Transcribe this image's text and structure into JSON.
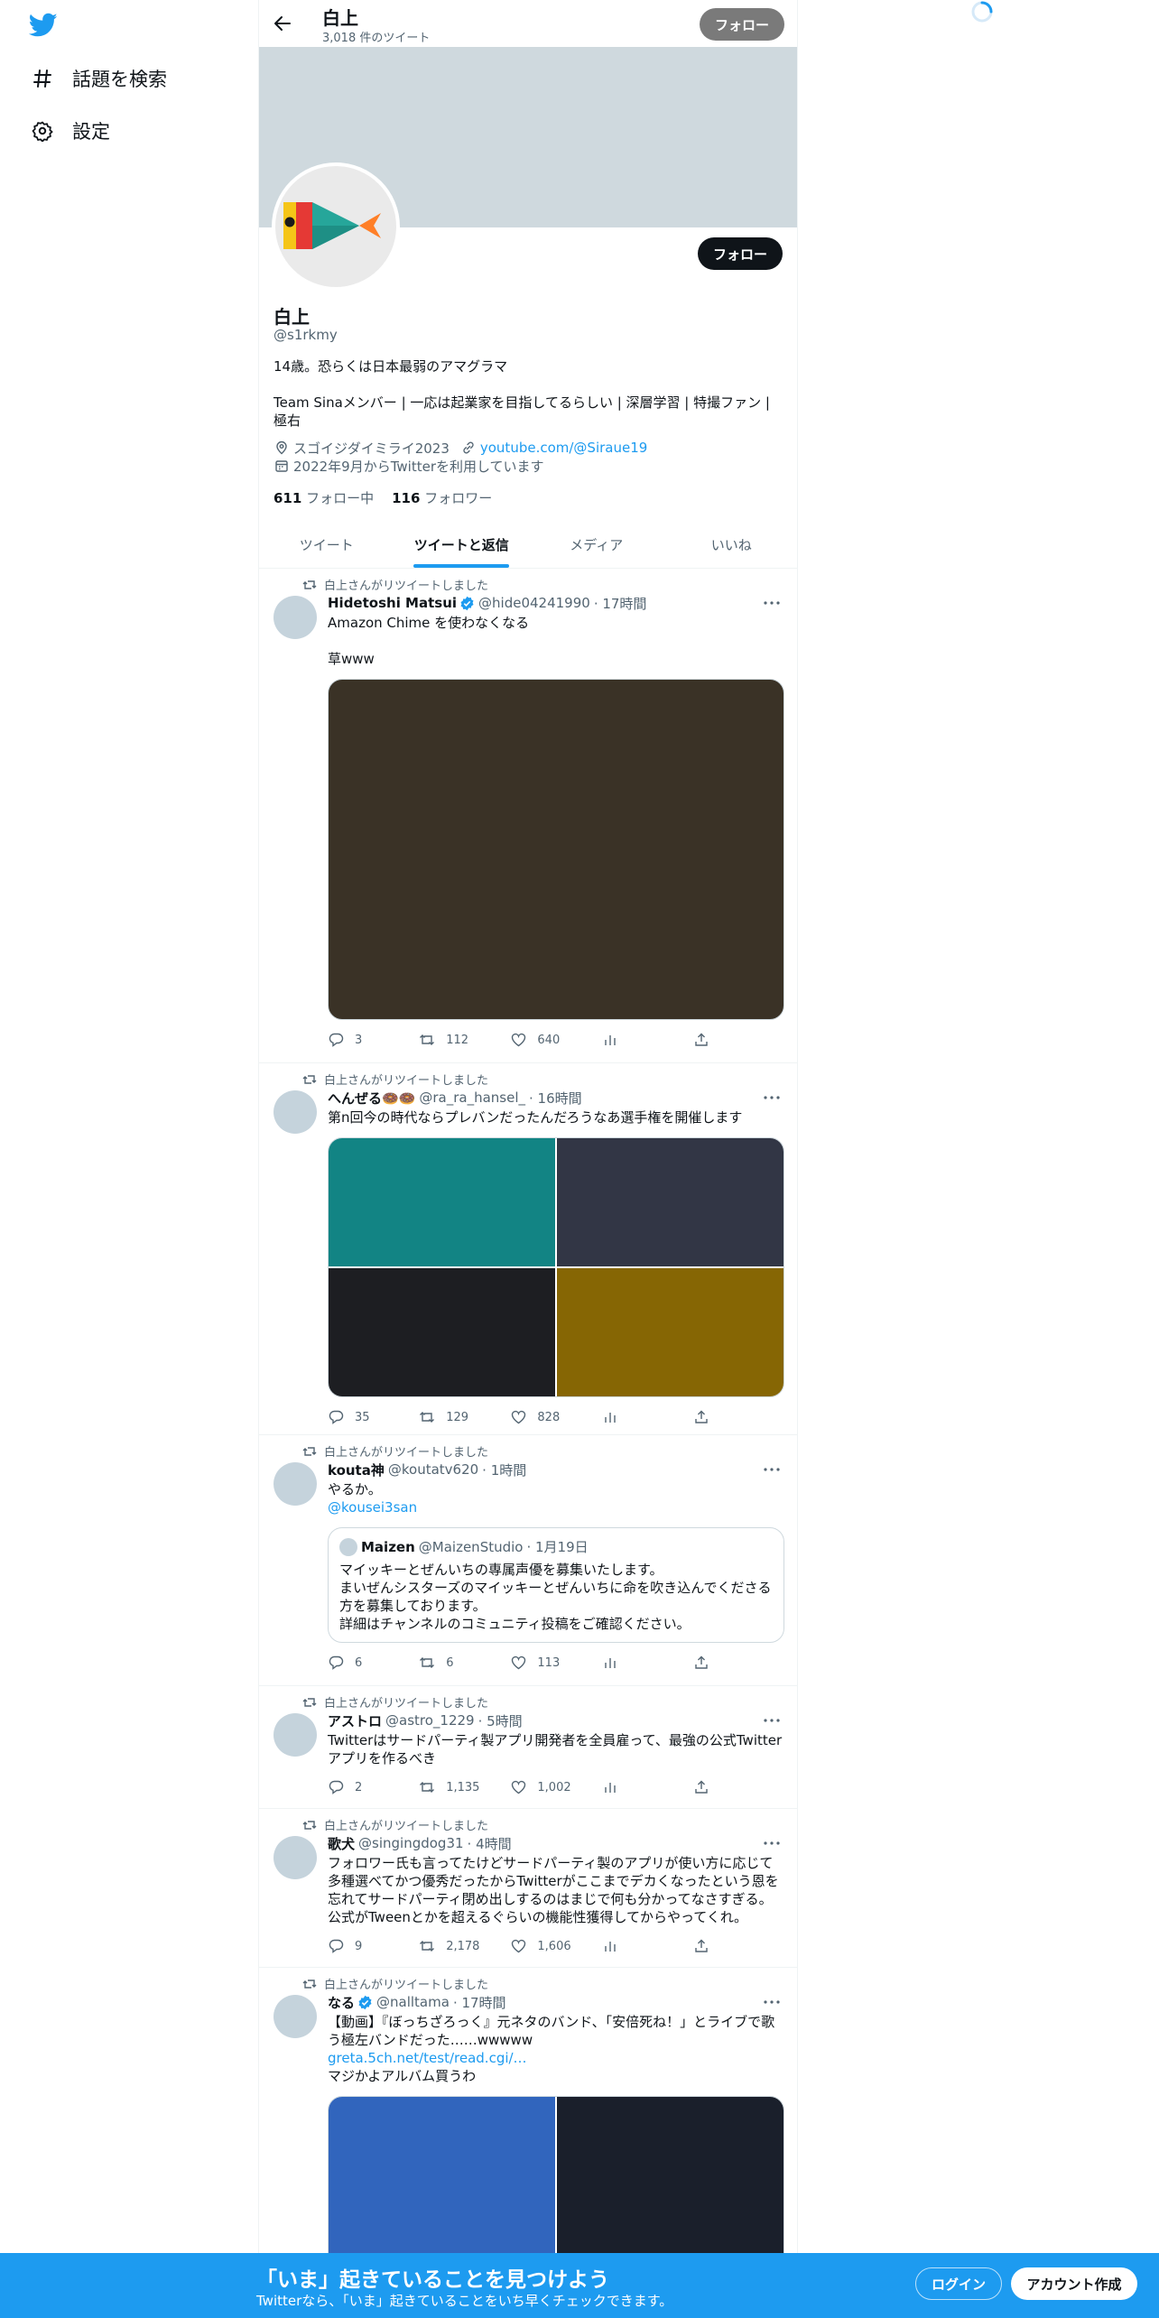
{
  "sidebar": {
    "items": [
      {
        "label": "話題を検索",
        "icon": "hashtag-icon"
      },
      {
        "label": "設定",
        "icon": "gear-icon"
      }
    ]
  },
  "header": {
    "name": "白上",
    "tweet_count": "3,018 件のツイート",
    "follow_label": "フォロー"
  },
  "profile": {
    "name": "白上",
    "handle": "@s1rkmy",
    "bio_line1": "14歳。恐らくは日本最弱のアマグラマ",
    "bio_line2": "Team Sinaメンバー | 一応は起業家を目指してるらしい | 深層学習 | 特撮ファン | 極右",
    "location": "スゴイジダイミライ2023",
    "website": "youtube.com/@Siraue19",
    "joined": "2022年9月からTwitterを利用しています",
    "following_count": "611",
    "following_label": "フォロー中",
    "followers_count": "116",
    "followers_label": "フォロワー",
    "follow_label": "フォロー",
    "avatar_colors": [
      "#f5c518",
      "#e53935",
      "#26a69a",
      "#ff7f27"
    ]
  },
  "tabs": [
    {
      "label": "ツイート",
      "active": false
    },
    {
      "label": "ツイートと返信",
      "active": true
    },
    {
      "label": "メディア",
      "active": false
    },
    {
      "label": "いいね",
      "active": false
    }
  ],
  "retweet_label": "白上さんがリツイートしました",
  "tweets": [
    {
      "name": "Hidetoshi Matsui",
      "verified": true,
      "handle": "@hide04241990",
      "time": "· 17時間",
      "text": [
        "Amazon Chime を使わなくなる",
        "",
        "草www"
      ],
      "media_colors": [
        "#3a3226"
      ],
      "replies": "3",
      "retweets": "112",
      "likes": "640"
    },
    {
      "name": "へんぜる🍩🍩",
      "verified": false,
      "handle": "@ra_ra_hansel_",
      "time": "· 16時間",
      "text": [
        "第n回今の時代ならプレバンだったんだろうなあ選手権を開催します"
      ],
      "media_colors": [
        "#128484",
        "#323645",
        "#1d1e22",
        "#866604"
      ],
      "replies": "35",
      "retweets": "129",
      "likes": "828"
    },
    {
      "name": "kouta神",
      "verified": false,
      "handle": "@koutatv620",
      "time": "· 1時間",
      "text": [
        "やるか。"
      ],
      "mention": "@kousei3san",
      "quote": {
        "name": "Maizen",
        "handle": "@MaizenStudio",
        "time": "· 1月19日",
        "lines": [
          "マイッキーとぜんいちの専属声優を募集いたします。",
          "まいぜんシスターズのマイッキーとぜんいちに命を吹き込んでくださる方を募集しております。",
          "詳細はチャンネルのコミュニティ投稿をご確認ください。"
        ]
      },
      "replies": "6",
      "retweets": "6",
      "likes": "113"
    },
    {
      "name": "アストロ",
      "verified": false,
      "handle": "@astro_1229",
      "time": "· 5時間",
      "text": [
        "Twitterはサードパーティ製アプリ開発者を全員雇って、最強の公式Twitterアプリを作るべき"
      ],
      "replies": "2",
      "retweets": "1,135",
      "likes": "1,002"
    },
    {
      "name": "歌犬",
      "verified": false,
      "handle": "@singingdog31",
      "time": "· 4時間",
      "text": [
        "フォロワー氏も言ってたけどサードパーティ製のアプリが使い方に応じて多種選べてかつ優秀だったからTwitterがここまでデカくなったという恩を忘れてサードパーティ閉め出しするのはまじで何も分かってなさすぎる。公式がTweenとかを超えるぐらいの機能性獲得してからやってくれ。"
      ],
      "replies": "9",
      "retweets": "2,178",
      "likes": "1,606"
    },
    {
      "name": "なる",
      "verified": true,
      "handle": "@nalltama",
      "time": "· 17時間",
      "text": [
        "【動画】『ぼっちざろっく』元ネタのバンド、「安倍死ね！」とライブで歌う極左バンドだった……wwwww"
      ],
      "link": "greta.5ch.net/test/read.cgi/…",
      "text2": "マジかよアルバム買うわ",
      "media_colors": [
        "#3165bd",
        "#1a1f2b"
      ]
    }
  ],
  "bottom_bar": {
    "title": "「いま」起きていることを見つけよう",
    "subtitle": "Twitterなら、「いま」起きていることをいち早くチェックできます。",
    "login_label": "ログイン",
    "signup_label": "アカウント作成"
  }
}
